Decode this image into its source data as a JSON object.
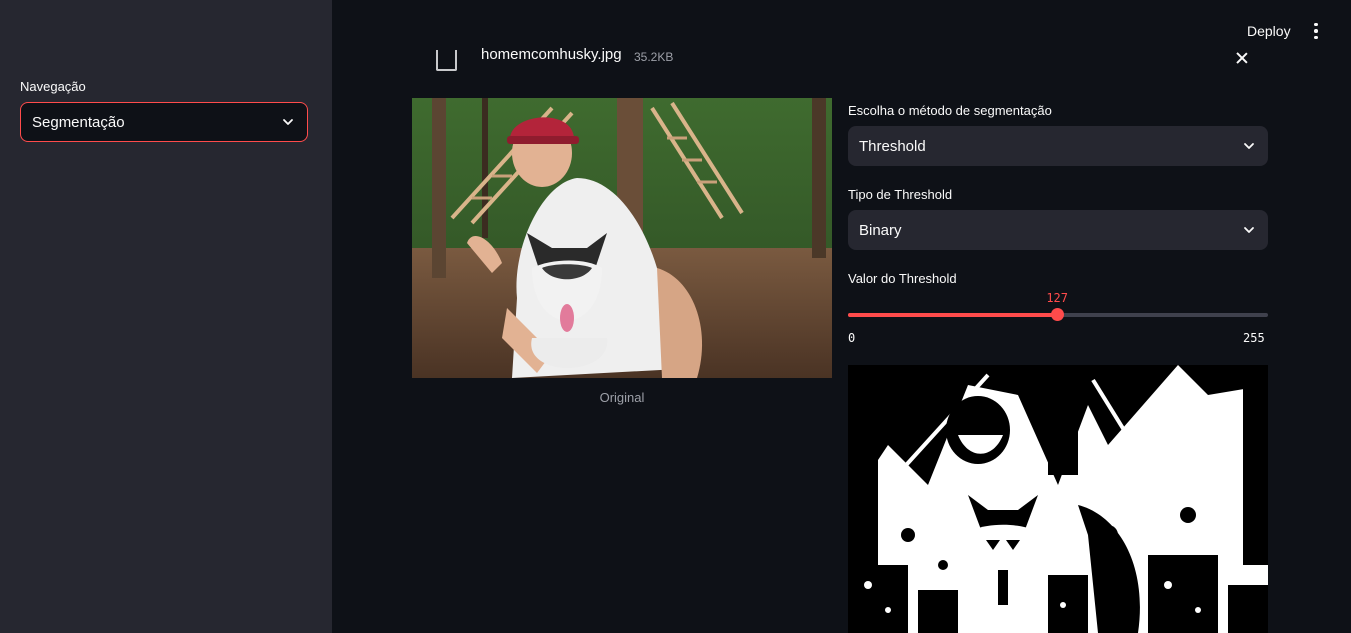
{
  "sidebar": {
    "nav_label": "Navegação",
    "nav_selected": "Segmentação"
  },
  "header": {
    "deploy_label": "Deploy"
  },
  "file": {
    "name": "homemcomhusky.jpg",
    "size": "35.2KB"
  },
  "original": {
    "caption": "Original"
  },
  "controls": {
    "method_label": "Escolha o método de segmentação",
    "method_value": "Threshold",
    "type_label": "Tipo de Threshold",
    "type_value": "Binary",
    "threshold_label": "Valor do Threshold",
    "threshold_value": "127",
    "threshold_min": "0",
    "threshold_max": "255"
  },
  "colors": {
    "accent": "#ff4b4b",
    "background": "#0e1117",
    "sidebar": "#262730"
  }
}
